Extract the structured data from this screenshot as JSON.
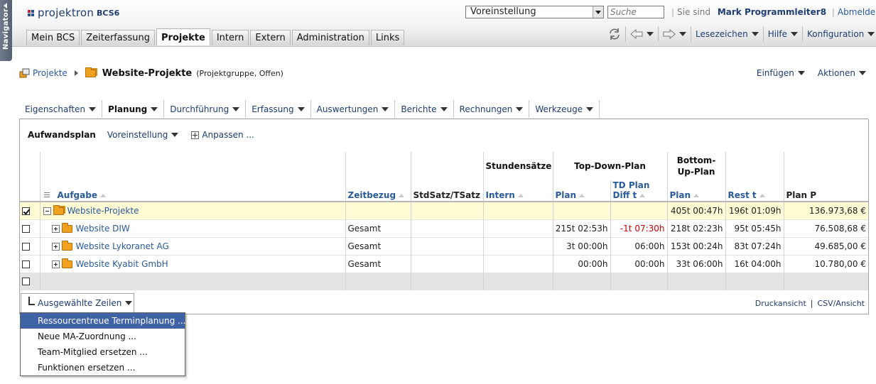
{
  "navigator": {
    "label": "Navigator"
  },
  "app": {
    "logo_text": "projektron",
    "logo_version": "BCS6"
  },
  "header": {
    "profile_value": "Voreinstellung",
    "search_placeholder": "Suche",
    "signed_in_prefix": "Sie sind",
    "user_name": "Mark Programmleiter8",
    "logout_label": "Abmelden"
  },
  "main_tabs": [
    {
      "label": "Mein BCS"
    },
    {
      "label": "Zeiterfassung"
    },
    {
      "label": "Projekte"
    },
    {
      "label": "Intern"
    },
    {
      "label": "Extern"
    },
    {
      "label": "Administration"
    },
    {
      "label": "Links"
    }
  ],
  "toolbar": {
    "bookmarks": "Lesezeichen",
    "help": "Hilfe",
    "config": "Konfiguration"
  },
  "breadcrumb": {
    "parent": "Projekte",
    "title": "Website-Projekte",
    "subtitle": "(Projektgruppe, Offen)"
  },
  "page_actions": {
    "insert": "Einfügen",
    "actions": "Aktionen"
  },
  "sub_tabs": [
    {
      "label": "Eigenschaften"
    },
    {
      "label": "Planung"
    },
    {
      "label": "Durchführung"
    },
    {
      "label": "Erfassung"
    },
    {
      "label": "Auswertungen"
    },
    {
      "label": "Berichte"
    },
    {
      "label": "Rechnungen"
    },
    {
      "label": "Werkzeuge"
    }
  ],
  "panel": {
    "title": "Aufwandsplan",
    "view": "Voreinstellung",
    "customize": "Anpassen ..."
  },
  "table": {
    "group_headers": {
      "stundensaetze": "Stundensätze",
      "top_down": "Top-Down-Plan",
      "bottom_up": "Bottom-Up-Plan"
    },
    "columns": {
      "aufgabe": "Aufgabe",
      "zeitbezug": "Zeitbezug",
      "stdsatz": "StdSatz/TSatz",
      "intern": "Intern",
      "plan_td": "Plan",
      "td_diff": "TD Plan Diff t",
      "plan_bu": "Plan",
      "rest": "Rest t",
      "plan_p": "Plan P"
    },
    "rows": [
      {
        "name": "Website-Projekte",
        "zeitbezug": "",
        "stdsatz": "",
        "intern": "",
        "plan_td": "",
        "td_diff": "",
        "plan_bu": "405t 00:47h",
        "rest": "196t 01:09h",
        "plan_p": "136.973,68 €"
      },
      {
        "name": "Website DIW",
        "zeitbezug": "Gesamt",
        "stdsatz": "",
        "intern": "",
        "plan_td": "215t 02:53h",
        "td_diff": "-1t 07:30h",
        "plan_bu": "218t 02:23h",
        "rest": "95t 05:45h",
        "plan_p": "76.508,68 €"
      },
      {
        "name": "Website Lykoranet AG",
        "zeitbezug": "Gesamt",
        "stdsatz": "",
        "intern": "",
        "plan_td": "3t 00:00h",
        "td_diff": "06:00h",
        "plan_bu": "153t 00:24h",
        "rest": "83t 07:24h",
        "plan_p": "49.685,00 €"
      },
      {
        "name": "Website Kyabit GmbH",
        "zeitbezug": "Gesamt",
        "stdsatz": "",
        "intern": "",
        "plan_td": "00:00h",
        "td_diff": "00:00h",
        "plan_bu": "33t 06:00h",
        "rest": "16t 04:00h",
        "plan_p": "10.780,00 €"
      }
    ]
  },
  "bulk_action": {
    "label": "Ausgewählte Zeilen"
  },
  "footer": {
    "print_view": "Druckansicht",
    "csv_view": "CSV/Ansicht"
  },
  "menu": [
    {
      "label": "Ressourcentreue Terminplanung ..."
    },
    {
      "label": "Neue MA-Zuordnung ..."
    },
    {
      "label": "Team-Mitglied ersetzen ..."
    },
    {
      "label": "Funktionen ersetzen ..."
    }
  ],
  "colors": {
    "link": "#2a5b9a",
    "selected_row": "#fffbd4",
    "menu_highlight": "#3f63a6",
    "negative": "#d20000"
  }
}
